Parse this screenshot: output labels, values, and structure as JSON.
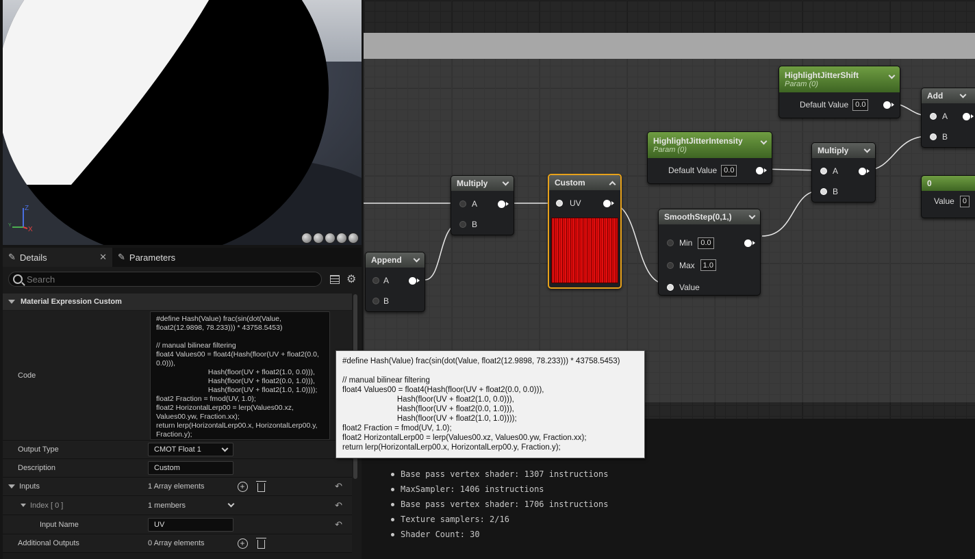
{
  "details": {
    "tabs": [
      {
        "label": "Details"
      },
      {
        "label": "Parameters"
      }
    ],
    "search_placeholder": "Search",
    "section_title": "Material Expression Custom",
    "code_label": "Code",
    "code_value": "#define Hash(Value) frac(sin(dot(Value, float2(12.9898, 78.233))) * 43758.5453)\n\n// manual bilinear filtering\nfloat4 Values00 = float4(Hash(floor(UV + float2(0.0, 0.0))),\n                          Hash(floor(UV + float2(1.0, 0.0))),\n                          Hash(floor(UV + float2(0.0, 1.0))),\n                          Hash(floor(UV + float2(1.0, 1.0))));\nfloat2 Fraction = fmod(UV, 1.0);\nfloat2 HorizontalLerp00 = lerp(Values00.xz, Values00.yw, Fraction.xx);\nreturn lerp(HorizontalLerp00.x, HorizontalLerp00.y, Fraction.y);",
    "output_type_label": "Output Type",
    "output_type_value": "CMOT Float 1",
    "description_label": "Description",
    "description_value": "Custom",
    "inputs_label": "Inputs",
    "inputs_value": "1 Array elements",
    "index_label": "Index [ 0 ]",
    "index_value": "1 members",
    "input_name_label": "Input Name",
    "input_name_value": "UV",
    "additional_outputs_label": "Additional Outputs",
    "additional_outputs_value": "0 Array elements"
  },
  "viewport": {
    "axis_z": "Z",
    "axis_x": "X",
    "axis_y": "Y"
  },
  "graph": {
    "nodes": {
      "append": {
        "title": "Append",
        "pin_a": "A",
        "pin_b": "B"
      },
      "multiply1": {
        "title": "Multiply",
        "pin_a": "A",
        "pin_b": "B"
      },
      "custom": {
        "title": "Custom",
        "pin_uv": "UV"
      },
      "smoothstep": {
        "title": "SmoothStep(0,1,)",
        "min_label": "Min",
        "min_value": "0.0",
        "max_label": "Max",
        "max_value": "1.0",
        "value_label": "Value"
      },
      "jitter_intensity": {
        "title": "HighlightJitterIntensity",
        "subtitle": "Param (0)",
        "default_label": "Default Value",
        "default_value": "0.0"
      },
      "jitter_shift": {
        "title": "HighlightJitterShift",
        "subtitle": "Param (0)",
        "default_label": "Default Value",
        "default_value": "0.0"
      },
      "multiply2": {
        "title": "Multiply",
        "pin_a": "A",
        "pin_b": "B"
      },
      "add": {
        "title": "Add",
        "pin_a": "A",
        "pin_b": "B"
      },
      "const": {
        "title": "0",
        "value_label": "Value",
        "value_partial": "0"
      }
    },
    "tooltip": "#define Hash(Value) frac(sin(dot(Value, float2(12.9898, 78.233))) * 43758.5453)\n\n// manual bilinear filtering\nfloat4 Values00 = float4(Hash(floor(UV + float2(0.0, 0.0))),\n                         Hash(floor(UV + float2(1.0, 0.0))),\n                         Hash(floor(UV + float2(0.0, 1.0))),\n                         Hash(floor(UV + float2(1.0, 1.0))));\nfloat2 Fraction = fmod(UV, 1.0);\nfloat2 HorizontalLerp00 = lerp(Values00.xz, Values00.yw, Fraction.xx);\nreturn lerp(HorizontalLerp00.x, HorizontalLerp00.y, Fraction.y);"
  },
  "stats": [
    "Base pass vertex shader: 1307 instructions",
    "MaxSampler: 1406 instructions",
    "Base pass vertex shader: 1706 instructions",
    "Texture samplers: 2/16",
    "Shader Count: 30"
  ]
}
